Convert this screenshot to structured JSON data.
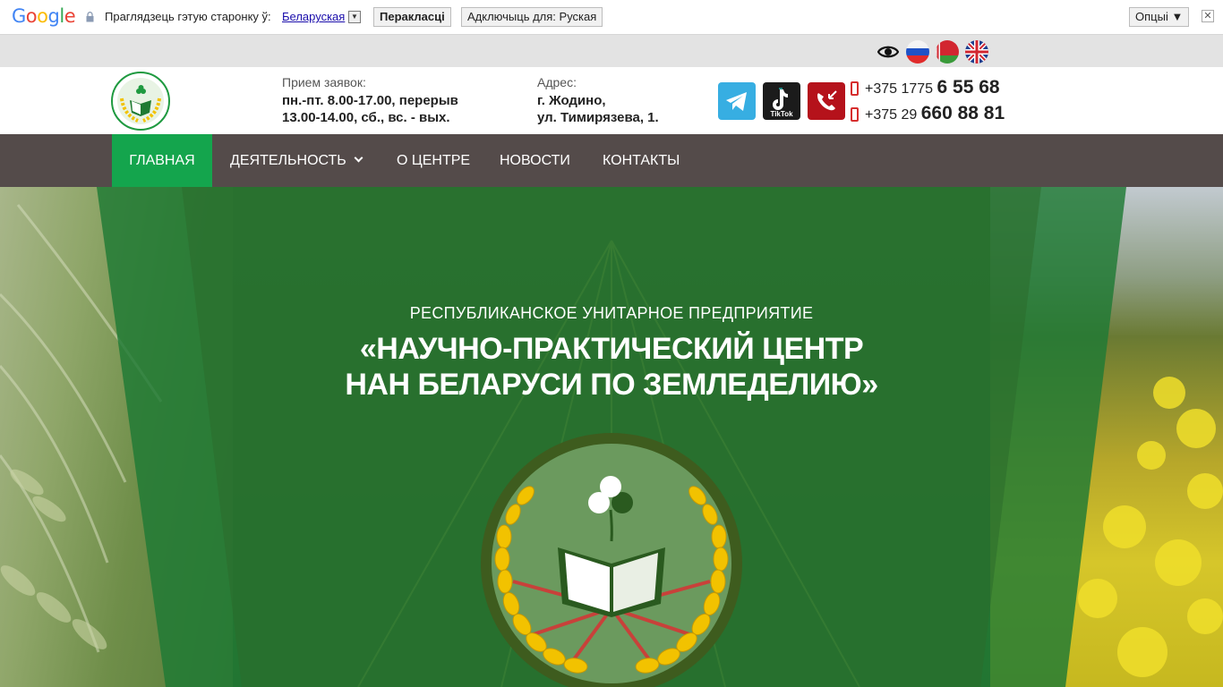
{
  "translate_bar": {
    "logo": "Google",
    "prompt": "Праглядзець гэтую старонку ў:",
    "language": "Беларуская",
    "translate_label": "Перакласці",
    "disable_label": "Адключыць для: Руская",
    "options_label": "Опцыі ▼",
    "close_label": "✕"
  },
  "topstrip": {
    "icons": [
      "eye-icon",
      "flag-russia",
      "flag-belarus",
      "flag-uk"
    ]
  },
  "header": {
    "hours_label": "Прием заявок:",
    "hours_line1": "пн.-пт. 8.00-17.00, перерыв",
    "hours_line2": "13.00-14.00, сб., вс. - вых.",
    "address_label": "Адрес:",
    "address_line1": "г. Жодино,",
    "address_line2": "ул. Тимирязева, 1.",
    "tiktok_label": "TikTok",
    "phones": [
      {
        "prefix": "+375 1775",
        "number": "6 55 68"
      },
      {
        "prefix": "+375 29",
        "number": "660 88 81"
      }
    ]
  },
  "nav": {
    "items": [
      {
        "label": "Главная",
        "active": true
      },
      {
        "label": "Деятельность",
        "dropdown": true
      },
      {
        "label": "О центре"
      },
      {
        "label": "Новости"
      },
      {
        "label": "Контакты"
      }
    ]
  },
  "hero": {
    "subtitle": "РЕСПУБЛИКАНСКОЕ УНИТАРНОЕ ПРЕДПРИЯТИЕ",
    "title_line1": "«НАУЧНО-ПРАКТИЧЕСКИЙ ЦЕНТР",
    "title_line2": "НАН БЕЛАРУСИ ПО ЗЕМЛЕДЕЛИЮ»"
  },
  "colors": {
    "nav_bg": "#544b4a",
    "nav_active": "#14a54d",
    "hero_panel": "#2e7a36",
    "telegram": "#37aee2",
    "callback": "#b5121b"
  }
}
